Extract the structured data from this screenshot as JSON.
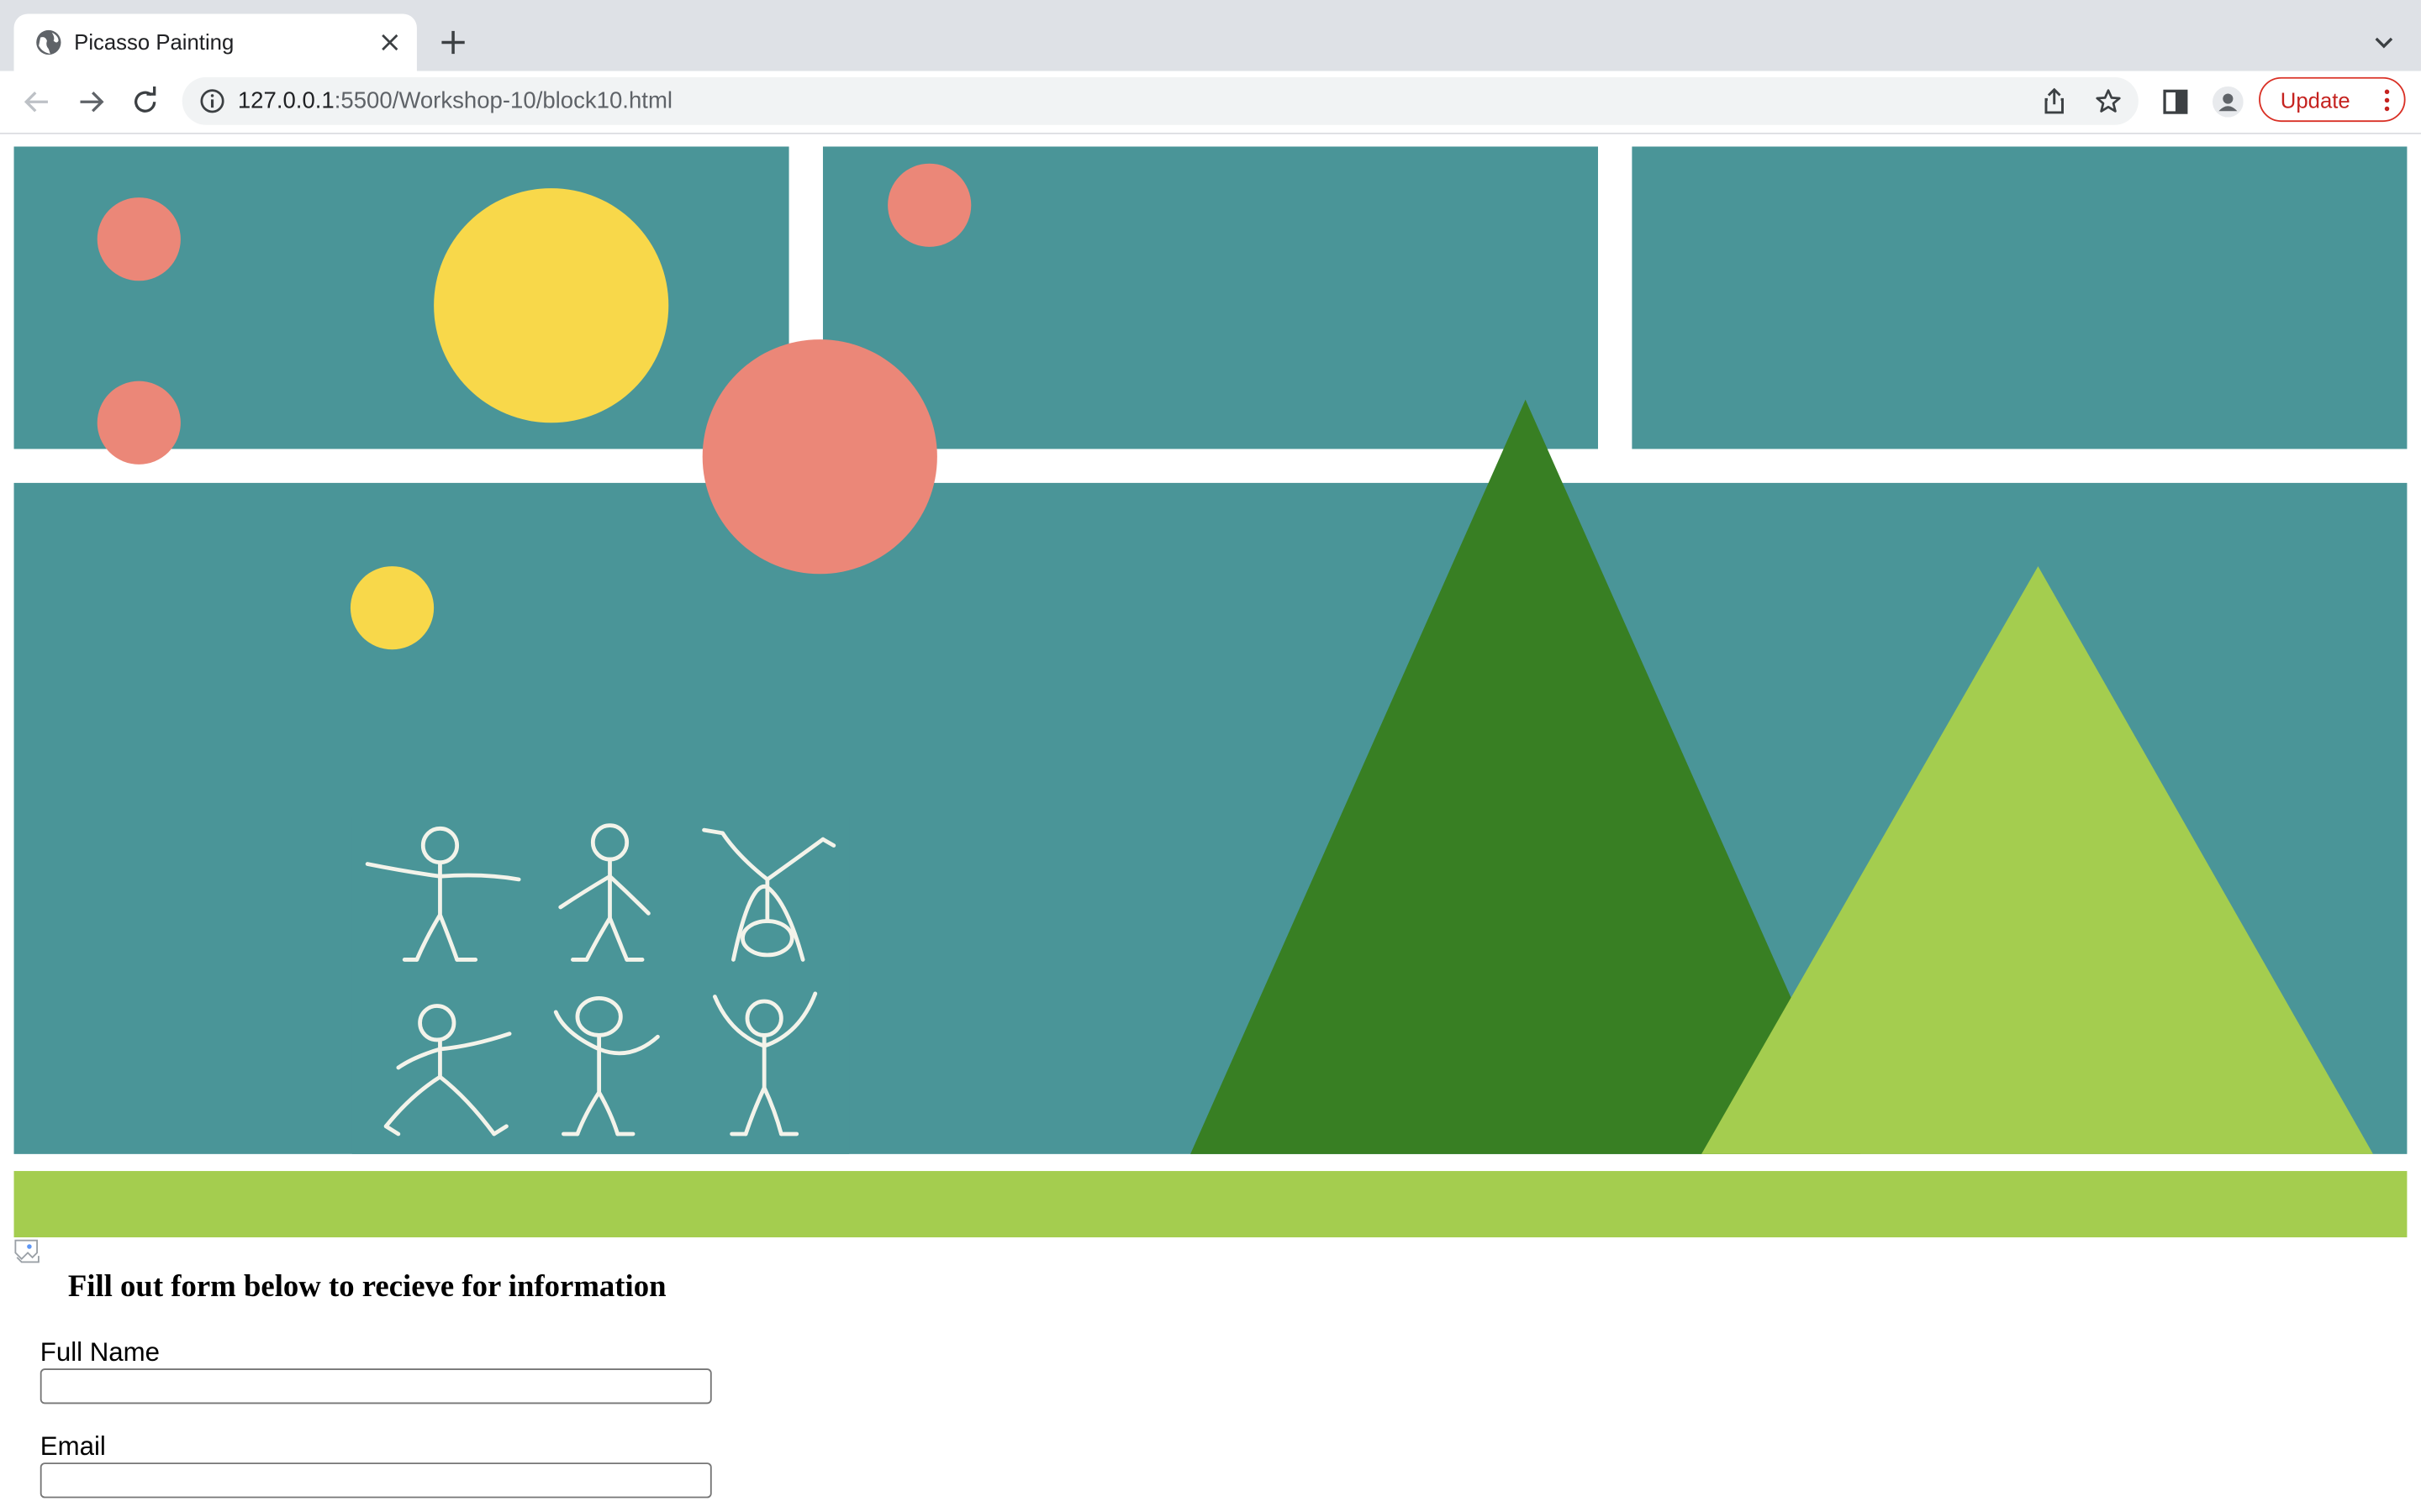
{
  "browser": {
    "tab_title": "Picasso Painting",
    "url_host": "127.0.0.1",
    "url_path": ":5500/Workshop-10/block10.html",
    "update_label": "Update"
  },
  "page": {
    "form_heading": "Fill out form below to recieve for information",
    "fields": [
      {
        "label": "Full Name",
        "value": ""
      },
      {
        "label": "Email",
        "value": ""
      }
    ]
  },
  "colors": {
    "panel": "#4a9598",
    "salmon": "#eb8778",
    "yellow": "#f8d84a",
    "dark_green": "#387f23",
    "light_green": "#a4cd4f"
  },
  "icons": [
    "globe-icon",
    "close-icon",
    "plus-icon",
    "chevron-down-icon",
    "back-arrow-icon",
    "forward-arrow-icon",
    "reload-icon",
    "info-icon",
    "share-icon",
    "star-icon",
    "side-panel-icon",
    "profile-icon",
    "more-vert-icon",
    "broken-image-icon"
  ]
}
